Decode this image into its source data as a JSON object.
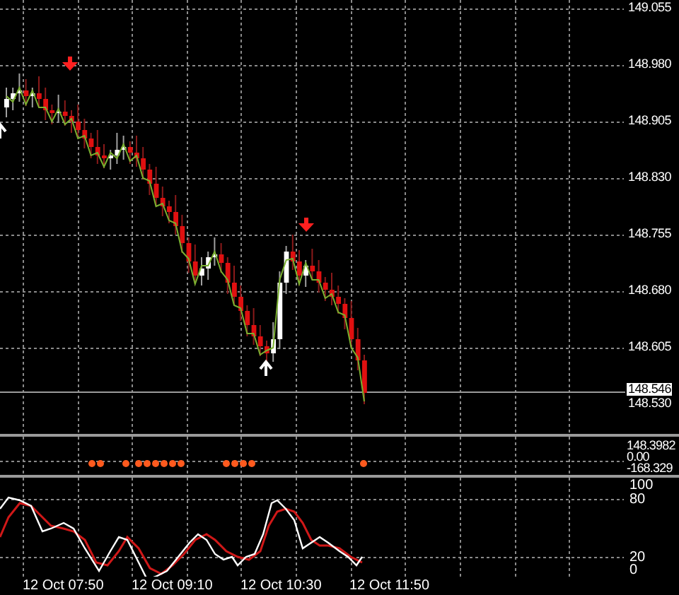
{
  "price_axis": {
    "ticks": [
      "149.055",
      "148.980",
      "148.905",
      "148.830",
      "148.755",
      "148.680",
      "148.605"
    ],
    "current_price": "148.546",
    "lower_label": "148.530"
  },
  "indicator_panel": {
    "axis_labels": [
      "148.3982",
      "0.00",
      "-168.329"
    ]
  },
  "oscillator_panel": {
    "axis_labels": [
      "100",
      "80",
      "20",
      "0"
    ]
  },
  "time_axis": {
    "labels": [
      "12 Oct 07:50",
      "12 Oct 09:10",
      "12 Oct 10:30",
      "12 Oct 11:50"
    ]
  }
}
